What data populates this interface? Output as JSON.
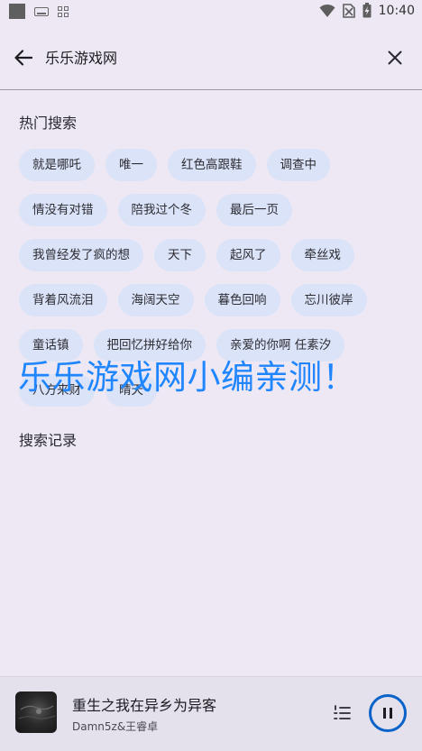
{
  "status_bar": {
    "time": "10:40"
  },
  "search": {
    "query": "乐乐游戏网"
  },
  "hot_search": {
    "title": "热门搜索",
    "rows": [
      [
        "就是哪吒",
        "唯一",
        "红色高跟鞋",
        "调查中"
      ],
      [
        "情没有对错",
        "陪我过个冬",
        "最后一页"
      ],
      [
        "我曾经发了疯的想",
        "天下",
        "起风了",
        "牵丝戏"
      ],
      [
        "背着风流泪",
        "海阔天空",
        "暮色回响",
        "忘川彼岸"
      ],
      [
        "童话镇",
        "把回忆拼好给你",
        "亲爱的你啊 任素汐"
      ],
      [
        "八方来财",
        "晴天"
      ]
    ]
  },
  "history": {
    "title": "搜索记录"
  },
  "watermark": "乐乐游戏网小编亲测！",
  "player": {
    "song_title": "重生之我在异乡为异客",
    "artist": "Damn5z&王睿卓"
  },
  "colors": {
    "background": "#EDE8F3",
    "chip": "#DAE3F8",
    "accent": "#0A63C9",
    "watermark": "#1F86FF"
  }
}
